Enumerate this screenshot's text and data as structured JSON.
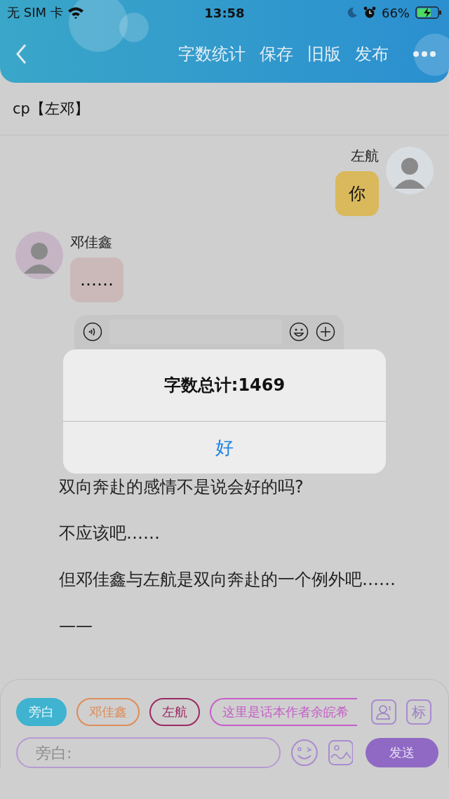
{
  "status_bar": {
    "carrier": "无 SIM 卡",
    "time": "13:58",
    "battery": "66%"
  },
  "header": {
    "actions": [
      "字数统计",
      "保存",
      "旧版",
      "发布"
    ]
  },
  "title": "cp【左邓】",
  "messages": [
    {
      "kind": "outgoing",
      "name": "左航",
      "text": "你",
      "color": "#d9b95c"
    },
    {
      "kind": "incoming",
      "name": "邓佳鑫",
      "text": "……",
      "color": "#cbb9b9"
    }
  ],
  "paragraphs": [
    {
      "text": "双向奔赴的感情不是说会好的吗?"
    },
    {
      "text": "不应该吧……"
    },
    {
      "text": "但邓佳鑫与左航是双向奔赴的一个例外吧……"
    },
    {
      "text": "——"
    }
  ],
  "alert": {
    "title": "字数总计:1469",
    "button": "好"
  },
  "composer": {
    "roles": [
      {
        "label": "旁白",
        "selected": true,
        "color": "#3fb3cf"
      },
      {
        "label": "邓佳鑫",
        "selected": false,
        "color": "#de8c58"
      },
      {
        "label": "左航",
        "selected": false,
        "color": "#9c2a62"
      },
      {
        "label": "这里是话本作者余皖希",
        "selected": false,
        "color": "#c55ec8"
      }
    ],
    "tag_button": "标",
    "placeholder": "旁白:",
    "send": "发送"
  }
}
